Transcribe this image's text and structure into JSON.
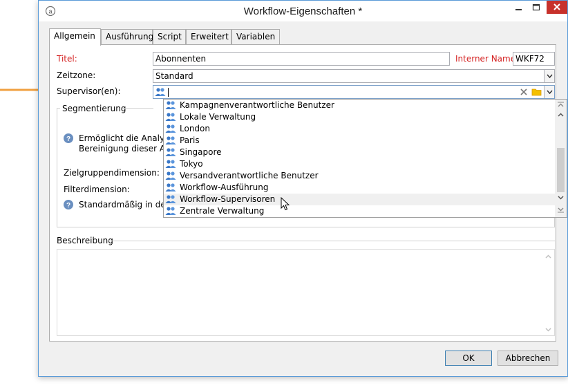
{
  "window": {
    "title": "Workflow-Eigenschaften *",
    "icon": "app-logo-icon",
    "controls": [
      "minimize-icon",
      "maximize-icon",
      "close-icon"
    ]
  },
  "annotation_arrow_color": "#f0a040",
  "tabs": [
    {
      "label": "Allgemein",
      "active": true
    },
    {
      "label": "Ausführung",
      "active": false
    },
    {
      "label": "Script",
      "active": false
    },
    {
      "label": "Erweitert",
      "active": false
    },
    {
      "label": "Variablen",
      "active": false
    }
  ],
  "form": {
    "title_label": "Titel:",
    "title_value": "Abonnenten",
    "internal_name_label": "Interner Name:",
    "internal_name_value": "WKF72",
    "timezone_label": "Zeitzone:",
    "timezone_value": "Standard",
    "supervisor_label": "Supervisor(en):",
    "supervisor_value": ""
  },
  "segmentation": {
    "heading": "Segmentierung",
    "help_text_line1": "Ermöglicht die Analy",
    "help_text_line2": "Bereinigung dieser A",
    "target_dimension_label": "Zielgruppendimension:",
    "filter_dimension_label": "Filterdimension:",
    "default_text": "Standardmäßig in de"
  },
  "supervisor_options": [
    {
      "label": "Kampagnenverantwortliche Benutzer"
    },
    {
      "label": "Lokale Verwaltung"
    },
    {
      "label": "London"
    },
    {
      "label": "Paris"
    },
    {
      "label": "Singapore"
    },
    {
      "label": "Tokyo"
    },
    {
      "label": "Versandverantwortliche Benutzer"
    },
    {
      "label": "Workflow-Ausführung"
    },
    {
      "label": "Workflow-Supervisoren",
      "hovered": true
    },
    {
      "label": "Zentrale Verwaltung"
    }
  ],
  "description": {
    "heading": "Beschreibung",
    "value": ""
  },
  "buttons": {
    "ok": "OK",
    "cancel": "Abbrechen"
  }
}
